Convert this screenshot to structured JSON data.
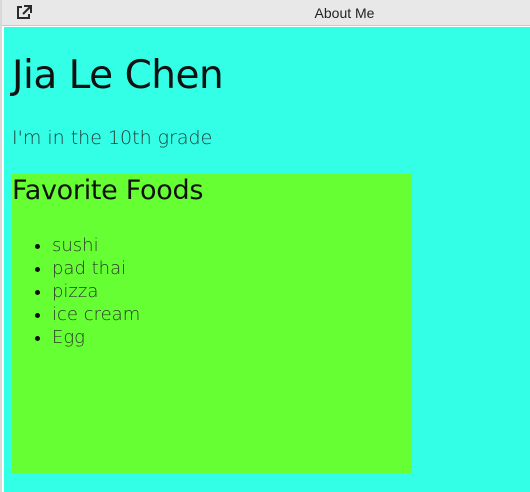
{
  "window": {
    "title": "About Me",
    "open_external_icon": "external-link-icon"
  },
  "page": {
    "background_color": "#33ffe6",
    "title": "Jia Le Chen",
    "subtitle": "I'm in the 10th grade",
    "favorite_foods": {
      "background_color": "#66ff33",
      "heading": "Favorite Foods",
      "items": [
        "sushi",
        "pad thai",
        "pizza",
        "ice cream",
        "Egg"
      ]
    }
  }
}
